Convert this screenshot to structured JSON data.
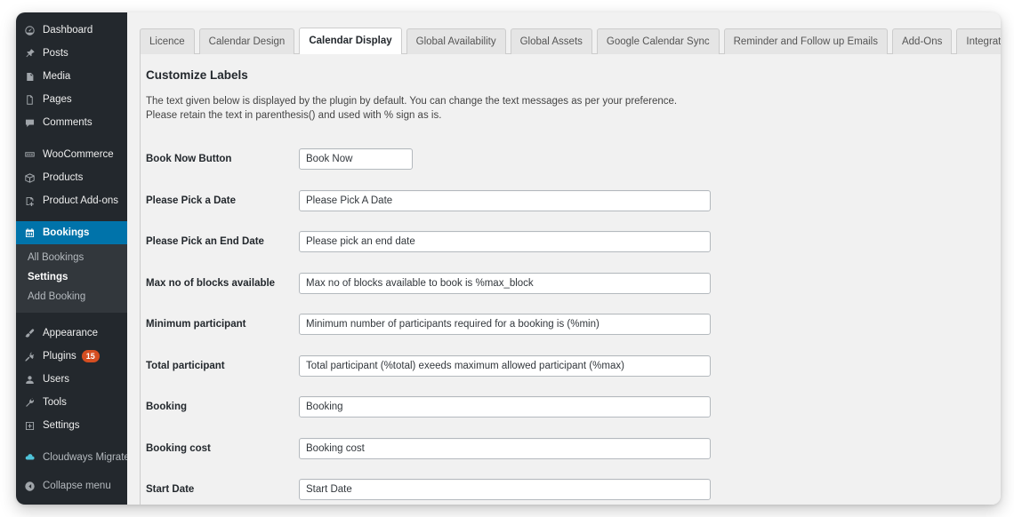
{
  "sidebar": {
    "items": [
      {
        "label": "Dashboard",
        "icon": "dashboard-icon"
      },
      {
        "label": "Posts",
        "icon": "pin-icon"
      },
      {
        "label": "Media",
        "icon": "media-icon"
      },
      {
        "label": "Pages",
        "icon": "pages-icon"
      },
      {
        "label": "Comments",
        "icon": "comments-icon"
      },
      {
        "label": "WooCommerce",
        "icon": "woocommerce-icon"
      },
      {
        "label": "Products",
        "icon": "products-icon"
      },
      {
        "label": "Product Add-ons",
        "icon": "product-addons-icon"
      },
      {
        "label": "Bookings",
        "icon": "calendar-icon"
      }
    ],
    "submenu": [
      {
        "label": "All Bookings",
        "active": false
      },
      {
        "label": "Settings",
        "active": true
      },
      {
        "label": "Add Booking",
        "active": false
      }
    ],
    "items_lower": [
      {
        "label": "Appearance",
        "icon": "brush-icon",
        "badge": ""
      },
      {
        "label": "Plugins",
        "icon": "plugin-icon",
        "badge": "15"
      },
      {
        "label": "Users",
        "icon": "user-icon",
        "badge": ""
      },
      {
        "label": "Tools",
        "icon": "wrench-icon",
        "badge": ""
      },
      {
        "label": "Settings",
        "icon": "settings-icon",
        "badge": ""
      }
    ],
    "items_footer": [
      {
        "label": "Cloudways Migrate",
        "icon": "cloud-icon"
      },
      {
        "label": "Collapse menu",
        "icon": "collapse-icon"
      }
    ],
    "colors": {
      "background": "#23282d",
      "submenu_background": "#32373c",
      "current": "#0073aa",
      "badge": "#d54e21"
    }
  },
  "tabs": [
    {
      "label": "Licence",
      "active": false
    },
    {
      "label": "Calendar Design",
      "active": false
    },
    {
      "label": "Calendar Display",
      "active": true
    },
    {
      "label": "Global Availability",
      "active": false
    },
    {
      "label": "Global Assets",
      "active": false
    },
    {
      "label": "Google Calendar Sync",
      "active": false
    },
    {
      "label": "Reminder and Follow up Emails",
      "active": false
    },
    {
      "label": "Add-Ons",
      "active": false
    },
    {
      "label": "Integrations",
      "active": false
    }
  ],
  "panel": {
    "title": "Customize Labels",
    "description_line1": "The text given below is displayed by the plugin by default. You can change the text messages as per your preference.",
    "description_line2": "Please retain the text in parenthesis() and used with % sign as is."
  },
  "fields": [
    {
      "label": "Book Now Button",
      "value": "Book Now",
      "width": "narrow"
    },
    {
      "label": "Please Pick a Date",
      "value": "Please Pick A Date",
      "width": "wide"
    },
    {
      "label": "Please Pick an End Date",
      "value": "Please pick an end date",
      "width": "wide"
    },
    {
      "label": "Max no of blocks available",
      "value": "Max no of blocks available to book is %max_block",
      "width": "wide"
    },
    {
      "label": "Minimum participant",
      "value": "Minimum number of participants required for a booking is (%min)",
      "width": "wide"
    },
    {
      "label": "Total participant",
      "value": "Total participant (%total) exeeds maximum allowed participant (%max)",
      "width": "wide"
    },
    {
      "label": "Booking",
      "value": "Booking",
      "width": "wide"
    },
    {
      "label": "Booking cost",
      "value": "Booking cost",
      "width": "wide"
    },
    {
      "label": "Start Date",
      "value": "Start Date",
      "width": "wide"
    }
  ]
}
